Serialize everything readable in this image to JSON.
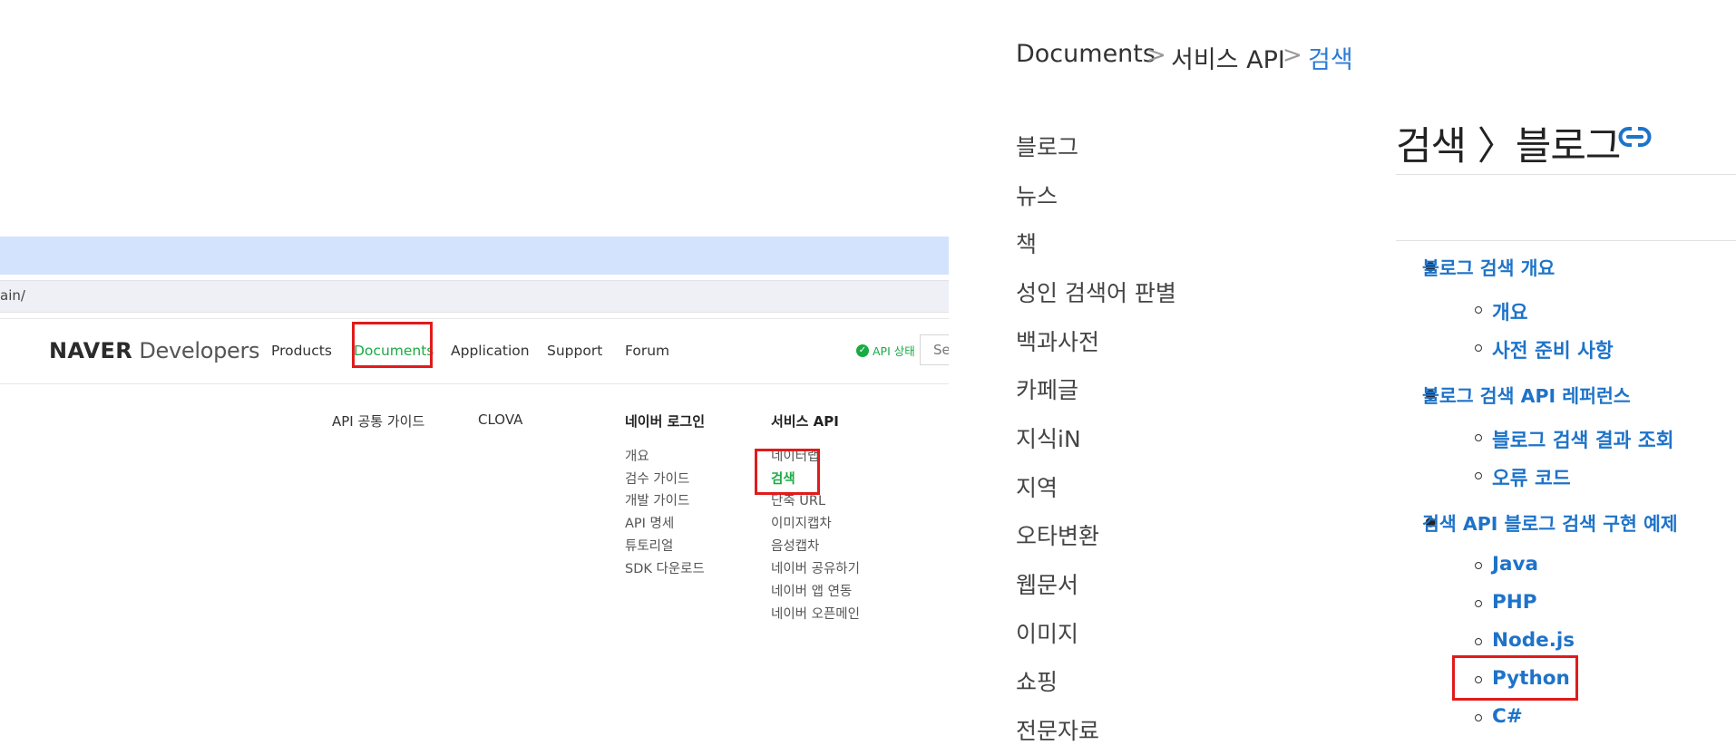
{
  "browser": {
    "url_fragment": "ain/"
  },
  "naver_nav": {
    "logo_brand": "NAVER",
    "logo_sub": "Developers",
    "items": [
      "Products",
      "Documents",
      "Application",
      "Support",
      "Forum"
    ],
    "api_status": "API 상태",
    "search_placeholder": "Sea"
  },
  "mega_menu": {
    "columns": [
      {
        "title": "API 공통 가이드",
        "items": []
      },
      {
        "title": "CLOVA",
        "items": []
      },
      {
        "title": "네이버 로그인",
        "items": [
          "개요",
          "검수 가이드",
          "개발 가이드",
          "API 명세",
          "튜토리얼",
          "SDK 다운로드"
        ]
      },
      {
        "title": "서비스 API",
        "items": [
          "네이터랩",
          "검색",
          "단축 URL",
          "이미지캡차",
          "음성캡차",
          "네이버 공유하기",
          "네이버 앱 연동",
          "네이버 오픈메인"
        ]
      }
    ]
  },
  "breadcrumb": [
    "Documents",
    "서비스 API",
    "검색"
  ],
  "sidebar": [
    "블로그",
    "뉴스",
    "책",
    "성인 검색어 판별",
    "백과사전",
    "카페글",
    "지식iN",
    "지역",
    "오타변환",
    "웹문서",
    "이미지",
    "쇼핑",
    "전문자료"
  ],
  "doc": {
    "title": "검색 〉블로그",
    "link_icon": "link-icon",
    "toc": [
      {
        "label": "블로그 검색 개요",
        "children": [
          "개요",
          "사전 준비 사항"
        ]
      },
      {
        "label": "블로그 검색 API 레퍼런스",
        "children": [
          "블로그 검색 결과 조회",
          "오류 코드"
        ]
      },
      {
        "label": "검색 API 블로그 검색 구현 예제",
        "children": [
          "Java",
          "PHP",
          "Node.js",
          "Python",
          "C#"
        ]
      }
    ]
  },
  "colors": {
    "naver_green": "#19ab43",
    "link_blue": "#1e73c9",
    "highlight_red": "#e11b1b"
  }
}
